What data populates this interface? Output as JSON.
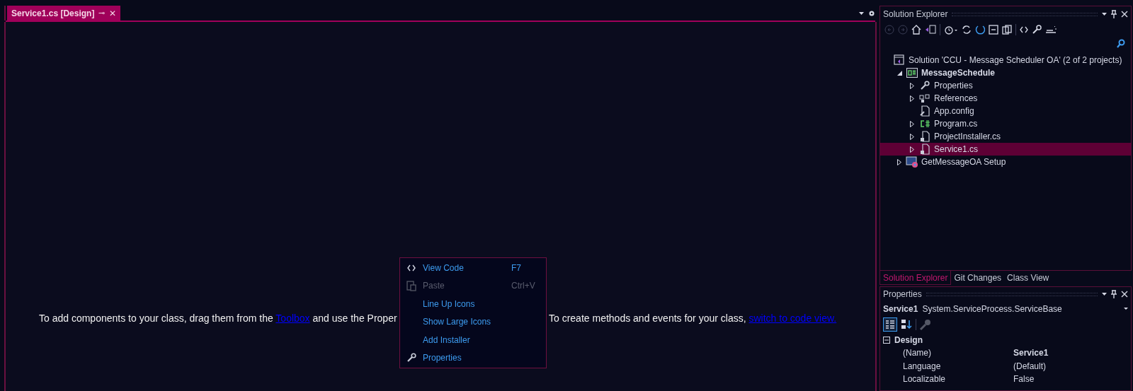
{
  "document_tab": {
    "title": "Service1.cs [Design]",
    "selected": true,
    "pin": "⊸",
    "close": "✕"
  },
  "designer_hint": [
    [
      {
        "kind": "text",
        "text": "To add components to your class, drag them from the "
      },
      {
        "kind": "link",
        "text": "Toolbox"
      },
      {
        "kind": "text",
        "text": " and use the Proper"
      }
    ],
    [
      {
        "kind": "text",
        "text": "To create methods and events for your class, "
      },
      {
        "kind": "link",
        "text": "switch to code view."
      }
    ]
  ],
  "context_menu": [
    {
      "kind": "code",
      "label": "View Code",
      "shortcut": "F7",
      "disabled": false
    },
    {
      "kind": "paste",
      "label": "Paste",
      "shortcut": "Ctrl+V",
      "disabled": true
    },
    {
      "kind": "plain",
      "label": "Line Up Icons",
      "disabled": false
    },
    {
      "kind": "plain",
      "label": "Show Large Icons",
      "disabled": false
    },
    {
      "kind": "plain",
      "label": "Add Installer",
      "disabled": false
    },
    {
      "kind": "wrench",
      "label": "Properties",
      "disabled": false
    }
  ],
  "solution_explorer": {
    "title": "Solution Explorer",
    "tree": [
      {
        "kind": "solution",
        "label": "Solution 'CCU - Message Scheduler OA' (2 of 2 projects)",
        "selected": false,
        "bold": false,
        "children": [
          {
            "kind": "csproj",
            "label": "MessageSchedule",
            "expanded": true,
            "selected": false,
            "bold": true,
            "children": [
              {
                "kind": "wrench",
                "label": "Properties",
                "expanded": false,
                "selected": false,
                "bold": false
              },
              {
                "kind": "references",
                "label": "References",
                "expanded": false,
                "selected": false,
                "bold": false
              },
              {
                "kind": "config",
                "label": "App.config",
                "selected": false,
                "bold": false
              },
              {
                "kind": "csharp",
                "label": "Program.cs",
                "expanded": false,
                "selected": false,
                "bold": false
              },
              {
                "kind": "designer",
                "label": "ProjectInstaller.cs",
                "expanded": false,
                "selected": false,
                "bold": false
              },
              {
                "kind": "designer",
                "label": "Service1.cs",
                "expanded": false,
                "selected": true,
                "bold": false
              }
            ]
          },
          {
            "kind": "setup",
            "label": "GetMessageOA Setup",
            "expanded": false,
            "selected": false,
            "bold": false
          }
        ]
      }
    ]
  },
  "tool_tabs": [
    {
      "label": "Solution Explorer",
      "selected": true
    },
    {
      "label": "Git Changes",
      "selected": false
    },
    {
      "label": "Class View",
      "selected": false
    }
  ],
  "properties": {
    "title": "Properties",
    "object_name": "Service1",
    "object_type": "System.ServiceProcess.ServiceBase",
    "category": {
      "label": "Design",
      "expanded": true
    },
    "rows": [
      {
        "name": "(Name)",
        "value": "Service1",
        "bold": true
      },
      {
        "name": "Language",
        "value": "(Default)",
        "bold": false
      },
      {
        "name": "Localizable",
        "value": "False",
        "bold": false
      }
    ]
  }
}
